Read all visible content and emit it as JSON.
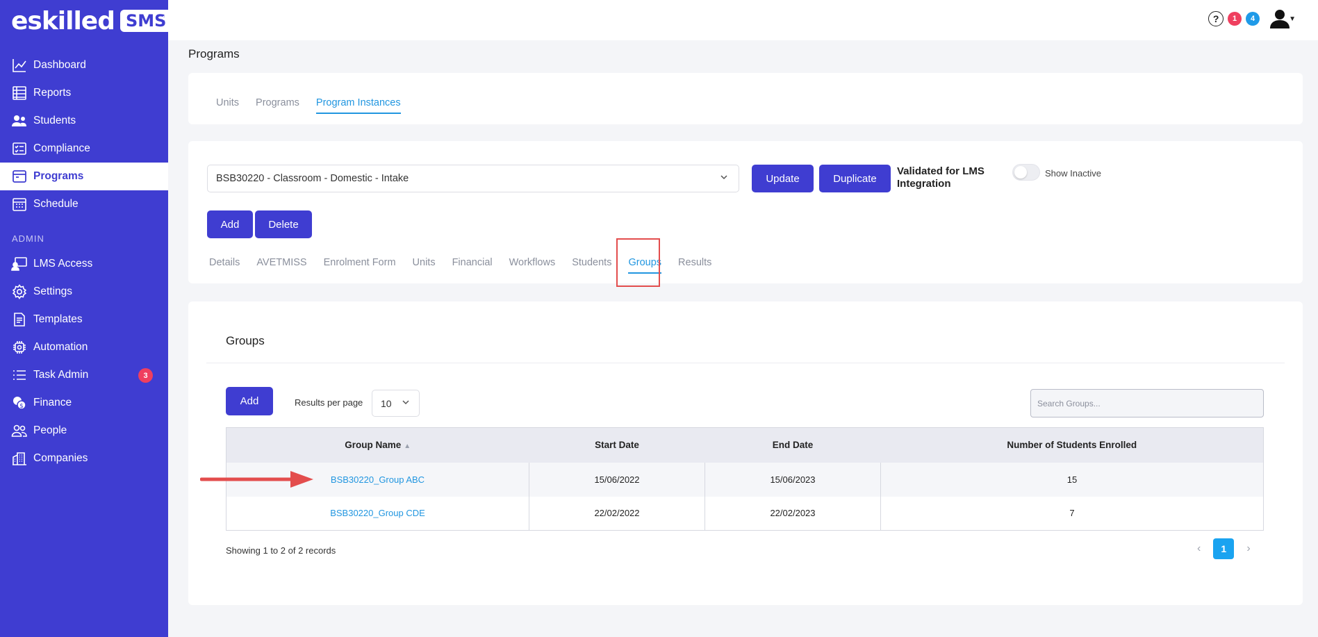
{
  "brand": {
    "word": "eskilled",
    "badge": "SMS"
  },
  "sidebar": {
    "items": [
      {
        "label": "Dashboard",
        "icon": "chart-line-icon"
      },
      {
        "label": "Reports",
        "icon": "table-icon"
      },
      {
        "label": "Students",
        "icon": "users-icon"
      },
      {
        "label": "Compliance",
        "icon": "checklist-icon"
      },
      {
        "label": "Programs",
        "icon": "window-icon",
        "active": true
      },
      {
        "label": "Schedule",
        "icon": "calendar-icon"
      }
    ],
    "admin_section": "ADMIN",
    "admin_items": [
      {
        "label": "LMS Access",
        "icon": "monitor-user-icon"
      },
      {
        "label": "Settings",
        "icon": "gear-icon"
      },
      {
        "label": "Templates",
        "icon": "document-icon"
      },
      {
        "label": "Automation",
        "icon": "chip-icon"
      },
      {
        "label": "Task Admin",
        "icon": "list-icon",
        "badge": "3"
      },
      {
        "label": "Finance",
        "icon": "coins-icon"
      },
      {
        "label": "People",
        "icon": "people-icon"
      },
      {
        "label": "Companies",
        "icon": "building-icon"
      }
    ]
  },
  "topbar": {
    "help": "?",
    "notif_pink": "1",
    "notif_blue": "4"
  },
  "page_title": "Programs",
  "top_tabs": [
    "Units",
    "Programs",
    "Program Instances"
  ],
  "instance": {
    "selected": "BSB30220 - Classroom - Domestic - Intake",
    "update_label": "Update",
    "duplicate_label": "Duplicate",
    "validated_label": "Validated for LMS Integration",
    "show_inactive_label": "Show Inactive",
    "add_label": "Add",
    "delete_label": "Delete"
  },
  "sub_tabs": [
    "Details",
    "AVETMISS",
    "Enrolment Form",
    "Units",
    "Financial",
    "Workflows",
    "Students",
    "Groups",
    "Results"
  ],
  "groups": {
    "title": "Groups",
    "add_label": "Add",
    "rpp_label": "Results per page",
    "rpp_value": "10",
    "search_placeholder": "Search Groups...",
    "columns": [
      "Group Name",
      "Start Date",
      "End Date",
      "Number of Students Enrolled"
    ],
    "rows": [
      {
        "name": "BSB30220_Group ABC",
        "start": "15/06/2022",
        "end": "15/06/2023",
        "enrolled": "15"
      },
      {
        "name": "BSB30220_Group CDE",
        "start": "22/02/2022",
        "end": "22/02/2023",
        "enrolled": "7"
      }
    ],
    "showing": "Showing 1 to 2 of 2 records",
    "page": "1"
  },
  "colors": {
    "primary": "#3f3dd1",
    "link": "#2196e0",
    "highlight": "#e34d4d"
  }
}
